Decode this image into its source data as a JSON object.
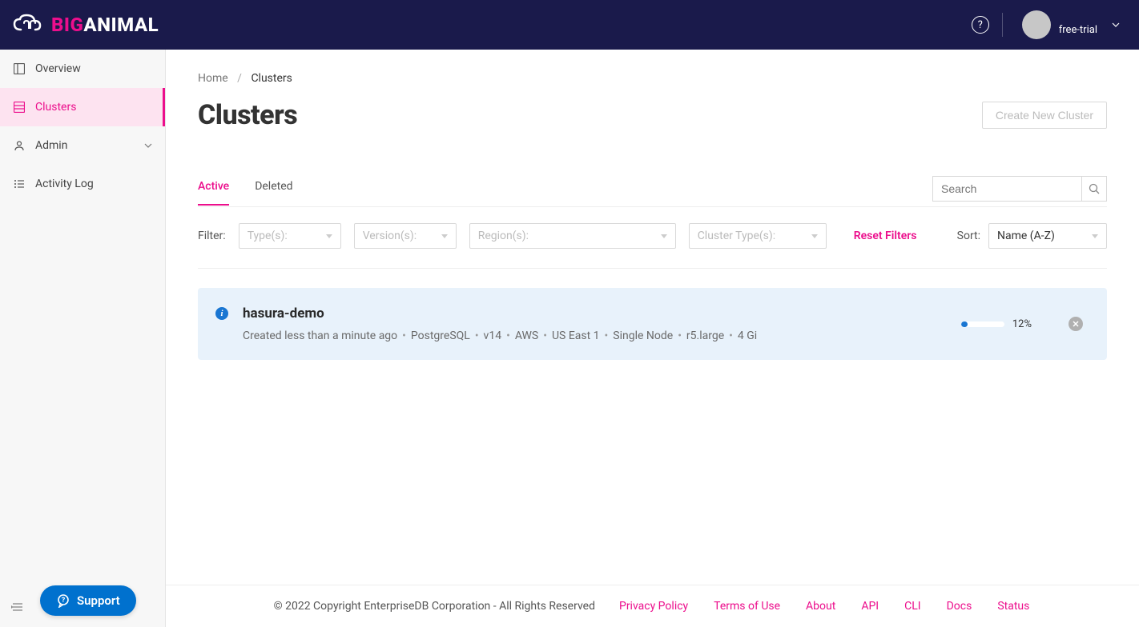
{
  "brand": {
    "big": "BIG",
    "animal": "ANIMAL"
  },
  "header": {
    "user_label": "free-trial"
  },
  "sidebar": {
    "items": [
      {
        "label": "Overview"
      },
      {
        "label": "Clusters"
      },
      {
        "label": "Admin"
      },
      {
        "label": "Activity Log"
      }
    ],
    "support_label": "Support"
  },
  "breadcrumb": {
    "home": "Home",
    "current": "Clusters"
  },
  "page": {
    "title": "Clusters",
    "create_button": "Create New Cluster"
  },
  "tabs": {
    "active": "Active",
    "deleted": "Deleted"
  },
  "search": {
    "placeholder": "Search"
  },
  "filters": {
    "label": "Filter:",
    "type": "Type(s):",
    "version": "Version(s):",
    "region": "Region(s):",
    "cluster_type": "Cluster Type(s):",
    "reset": "Reset Filters",
    "sort_label": "Sort:",
    "sort_value": "Name (A-Z)"
  },
  "cluster": {
    "name": "hasura-demo",
    "meta": {
      "created": "Created less than a minute ago",
      "engine": "PostgreSQL",
      "version": "v14",
      "provider": "AWS",
      "region": "US East 1",
      "topology": "Single Node",
      "instance": "r5.large",
      "storage": "4 Gi"
    },
    "progress_percent": "12%"
  },
  "footer": {
    "copyright": "© 2022 Copyright EnterpriseDB Corporation - All Rights Reserved",
    "links": {
      "privacy": "Privacy Policy",
      "terms": "Terms of Use",
      "about": "About",
      "api": "API",
      "cli": "CLI",
      "docs": "Docs",
      "status": "Status"
    }
  }
}
